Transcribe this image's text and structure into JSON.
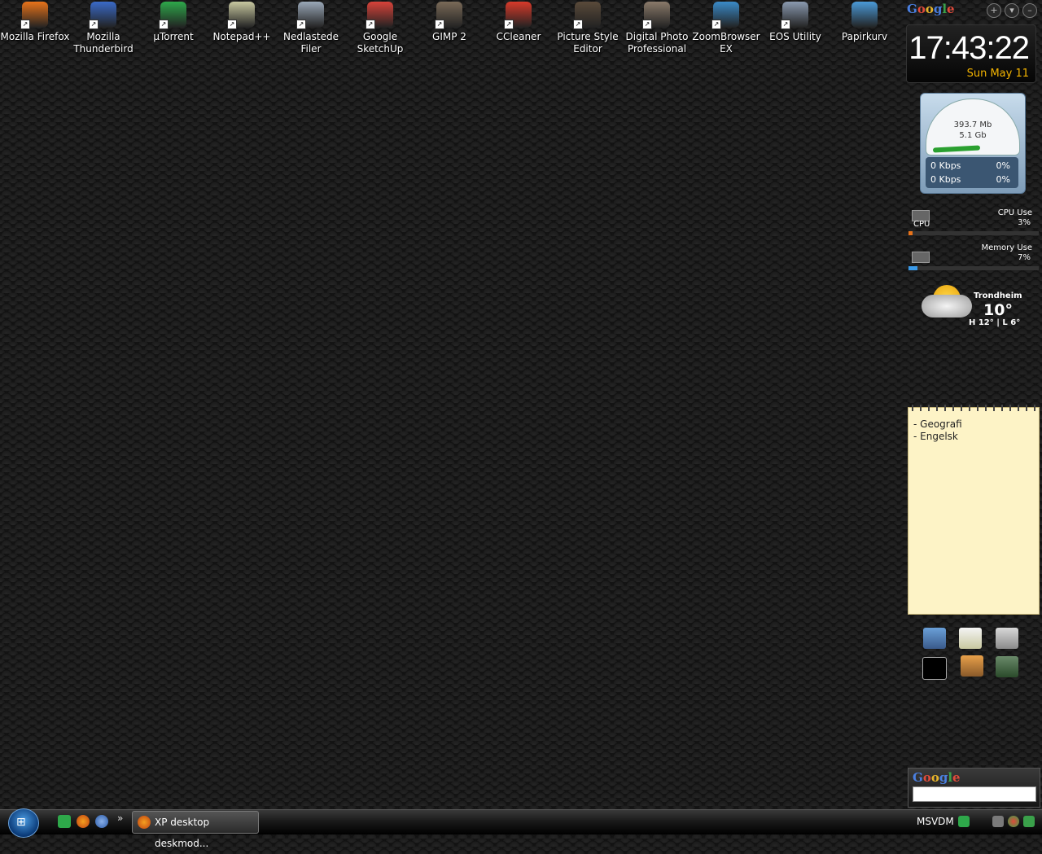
{
  "desktop": {
    "icons": [
      {
        "label": "Mozilla Firefox",
        "icon": "firefox-icon",
        "color": "#e8731a"
      },
      {
        "label": "Mozilla Thunderbird",
        "icon": "thunderbird-icon",
        "color": "#3a6ac8"
      },
      {
        "label": "µTorrent",
        "icon": "utorrent-icon",
        "color": "#2ea84a"
      },
      {
        "label": "Notepad++",
        "icon": "notepad-plus-plus-icon",
        "color": "#c8c8a0"
      },
      {
        "label": "Nedlastede Filer",
        "icon": "downloads-drive-icon",
        "color": "#9aa8b8"
      },
      {
        "label": "Google SketchUp",
        "icon": "sketchup-icon",
        "color": "#d8433a"
      },
      {
        "label": "GIMP 2",
        "icon": "gimp-icon",
        "color": "#7a6a58"
      },
      {
        "label": "CCleaner",
        "icon": "ccleaner-icon",
        "color": "#d83a2a"
      },
      {
        "label": "Picture Style Editor",
        "icon": "picture-style-editor-icon",
        "color": "#5a4a3a"
      },
      {
        "label": "Digital Photo Professional",
        "icon": "digital-photo-professional-icon",
        "color": "#8a7a6a"
      },
      {
        "label": "ZoomBrowser EX",
        "icon": "zoombrowser-icon",
        "color": "#3a8ac8"
      },
      {
        "label": "EOS Utility",
        "icon": "eos-utility-icon",
        "color": "#8a9ab0"
      },
      {
        "label": "Papirkurv",
        "icon": "recycle-bin-icon",
        "color": "#4a9ad8"
      }
    ]
  },
  "sidebar": {
    "google_logo": [
      "G",
      "o",
      "o",
      "g",
      "l",
      "e"
    ],
    "add_label": "+",
    "menu_label": "▾",
    "minimize_label": "–"
  },
  "clock": {
    "time": "17:43:22",
    "date": "Sun May 11"
  },
  "network": {
    "value1": "393.7 Mb",
    "value2": "5.1 Gb",
    "rows": [
      {
        "rate": "0 Kbps",
        "percent": "0%"
      },
      {
        "rate": "0 Kbps",
        "percent": "0%"
      }
    ]
  },
  "cpu_meter": {
    "chip_label": "CPU",
    "title": "CPU Use",
    "percent": "3%",
    "fill_fraction": 0.03,
    "color": "#e8731a"
  },
  "memory_meter": {
    "title": "Memory Use",
    "percent": "7%",
    "fill_fraction": 0.07,
    "color": "#3a9ae8"
  },
  "weather": {
    "city": "Trondheim",
    "temperature": "10°",
    "high_low": "H 12° | L 6°"
  },
  "notes": {
    "lines": [
      "- Geografi",
      "- Engelsk"
    ]
  },
  "launcher": {
    "icons": [
      "network-connections-icon",
      "notepad-icon",
      "calculator-icon",
      "command-prompt-icon",
      "paint-icon",
      "remote-desktop-icon"
    ]
  },
  "google_search": {
    "logo": "Google",
    "value": ""
  },
  "taskbar": {
    "start_glyph": "⊞",
    "quick_launch": [
      "utorrent-icon",
      "firefox-icon",
      "thunderbird-icon"
    ],
    "overflow": "»",
    "task_label": "XP desktop deskmod...",
    "tray_label": "MSVDM",
    "tray_icons": [
      "msvdm-icon",
      "network-tools-icon",
      "google-tray-icon",
      "network-status-icon"
    ]
  }
}
